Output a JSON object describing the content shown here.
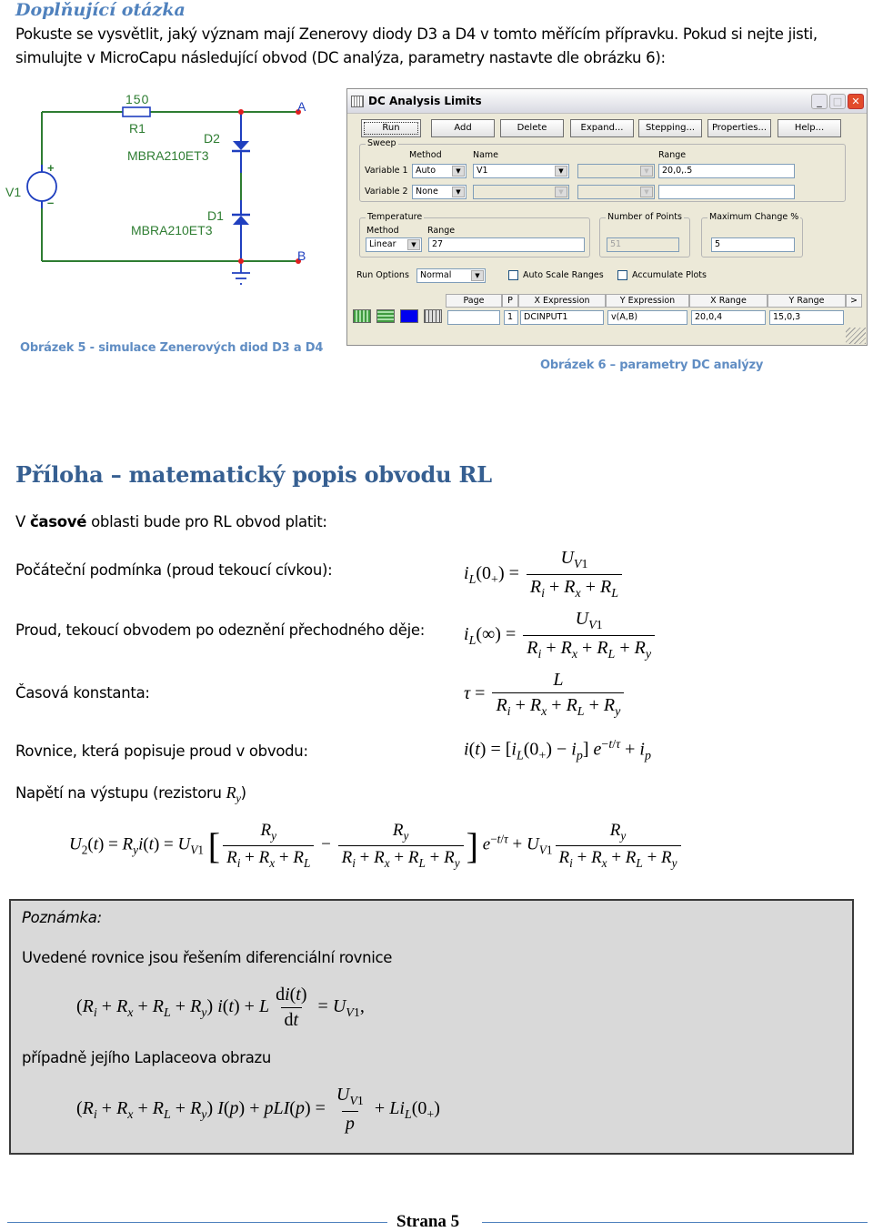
{
  "header": {
    "title": "Doplňující otázka",
    "intro_line1": "Pokuste se vysvětlit, jaký význam mají Zenerovy diody D3 a D4 v tomto měřícím přípravku. Pokud si nejte jisti,",
    "intro_line2": "simulujte v MicroCapu následující obvod (DC analýza, parametry nastavte dle obrázku 6):"
  },
  "schematic": {
    "resistor_value": "150",
    "resistor_name": "R1",
    "diode_top_name": "D2",
    "diode_top_model": "MBRA210ET3",
    "diode_bottom_name": "D1",
    "diode_bottom_model": "MBRA210ET3",
    "source_name": "V1",
    "plus": "+",
    "minus": "–",
    "node_a": "A",
    "node_b": "B",
    "wire_color": "#2e7d32",
    "component_color": "#1f3fbf",
    "node_color": "#e02020",
    "caption": "Obrázek 5 - simulace  Zenerových diod D3 a D4"
  },
  "dialog": {
    "title": "DC Analysis Limits",
    "window_buttons": {
      "minimize": "_",
      "maximize": "□",
      "close": "✕"
    },
    "buttons": [
      "Run",
      "Add",
      "Delete",
      "Expand...",
      "Stepping...",
      "Properties...",
      "Help..."
    ],
    "sweep": {
      "label": "Sweep",
      "method_header": "Method",
      "name_header": "Name",
      "range_header": "Range",
      "variable1": {
        "label": "Variable 1",
        "method": "Auto",
        "name": "V1",
        "range": "20,0,.5"
      },
      "variable2": {
        "label": "Variable 2",
        "method": "None",
        "name": "",
        "range": ""
      }
    },
    "temperature": {
      "label": "Temperature",
      "method_header": "Method",
      "range_header": "Range",
      "method": "Linear",
      "range": "27"
    },
    "number_of_points": {
      "label": "Number of Points",
      "value": "51"
    },
    "maximum_change": {
      "label": "Maximum Change %",
      "value": "5"
    },
    "run_options": {
      "label": "Run Options",
      "value": "Normal"
    },
    "auto_scale_ranges": {
      "label": "Auto Scale Ranges",
      "checked": false
    },
    "accumulate_plots": {
      "label": "Accumulate Plots",
      "checked": false
    },
    "plot_table": {
      "headers": [
        "Page",
        "P",
        "X Expression",
        "Y Expression",
        "X Range",
        "Y Range",
        ">"
      ],
      "row": {
        "page": "",
        "p": "1",
        "x_expression": "DCINPUT1",
        "y_expression": "v(A,B)",
        "x_range": "20,0,4",
        "y_range": "15,0,3"
      }
    },
    "icons": [
      "grid-vertical-icon",
      "grid-horizontal-icon",
      "color-icon",
      "table-icon"
    ],
    "caption": "Obrázek 6 – parametry DC analýzy"
  },
  "appendix": {
    "title": "Příloha – matematický popis obvodu RL",
    "intro_prefix": "V ",
    "intro_bold": "časové",
    "intro_suffix": " oblasti bude pro RL obvod platit:",
    "rows": [
      {
        "label": "Počáteční podmínka (proud tekoucí cívkou):"
      },
      {
        "label": "Proud, tekoucí obvodem po odeznění přechodného děje:"
      },
      {
        "label": "Časová konstanta:"
      },
      {
        "label": "Rovnice, která popisuje proud v obvodu:"
      }
    ],
    "output_voltage_label": "Napětí na výstupu (rezistoru ",
    "output_voltage_label_end": ")"
  },
  "note": {
    "title": "Poznámka:",
    "text1": "Uvedené rovnice jsou řešením diferenciální rovnice",
    "text2": "případně jejího Laplaceova obrazu"
  },
  "footer": {
    "page_label": "Strana 5"
  }
}
